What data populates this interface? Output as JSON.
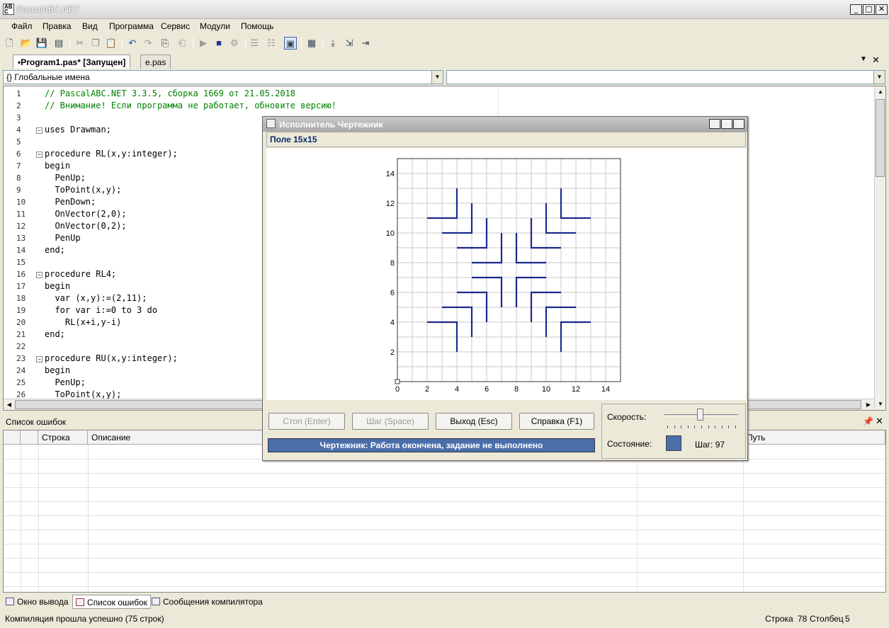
{
  "window": {
    "title": "PascalABC.NET"
  },
  "menu": [
    "Файл",
    "Правка",
    "Вид",
    "Программа",
    "Сервис",
    "Модули",
    "Помощь"
  ],
  "tabs": [
    {
      "label": "•Program1.pas* [Запущен]",
      "active": true
    },
    {
      "label": "e.pas",
      "active": false
    }
  ],
  "dropdowns": {
    "left": "{} Глобальные имена",
    "right": ""
  },
  "editor": {
    "lines": [
      {
        "n": "1",
        "text": "// PascalABC.NET 3.3.5, сборка 1669 от 21.05.2018",
        "kind": "comment"
      },
      {
        "n": "2",
        "text": "// Внимание! Если программа не работает, обновите версию!",
        "kind": "comment"
      },
      {
        "n": "3",
        "text": "",
        "kind": "code"
      },
      {
        "n": "4",
        "text": "uses Drawman;",
        "kind": "code",
        "fold": true
      },
      {
        "n": "5",
        "text": "",
        "kind": "code"
      },
      {
        "n": "6",
        "text": "procedure RL(x,y:integer);",
        "kind": "code",
        "fold": true
      },
      {
        "n": "7",
        "text": "begin",
        "kind": "code"
      },
      {
        "n": "8",
        "text": "  PenUp;",
        "kind": "code"
      },
      {
        "n": "9",
        "text": "  ToPoint(x,y);",
        "kind": "code"
      },
      {
        "n": "10",
        "text": "  PenDown;",
        "kind": "code"
      },
      {
        "n": "11",
        "text": "  OnVector(2,0);",
        "kind": "code"
      },
      {
        "n": "12",
        "text": "  OnVector(0,2);",
        "kind": "code"
      },
      {
        "n": "13",
        "text": "  PenUp",
        "kind": "code"
      },
      {
        "n": "14",
        "text": "end;",
        "kind": "code"
      },
      {
        "n": "15",
        "text": "",
        "kind": "code"
      },
      {
        "n": "16",
        "text": "procedure RL4;",
        "kind": "code",
        "fold": true
      },
      {
        "n": "17",
        "text": "begin",
        "kind": "code"
      },
      {
        "n": "18",
        "text": "  var (x,y):=(2,11);",
        "kind": "code"
      },
      {
        "n": "19",
        "text": "  for var i:=0 to 3 do",
        "kind": "code"
      },
      {
        "n": "20",
        "text": "    RL(x+i,y-i)",
        "kind": "code"
      },
      {
        "n": "21",
        "text": "end;",
        "kind": "code"
      },
      {
        "n": "22",
        "text": "",
        "kind": "code"
      },
      {
        "n": "23",
        "text": "procedure RU(x,y:integer);",
        "kind": "code",
        "fold": true
      },
      {
        "n": "24",
        "text": "begin",
        "kind": "code"
      },
      {
        "n": "25",
        "text": "  PenUp;",
        "kind": "code"
      },
      {
        "n": "26",
        "text": "  ToPoint(x,y);",
        "kind": "code"
      }
    ]
  },
  "errors_panel": {
    "title": "Список ошибок",
    "columns": [
      "",
      "",
      "Строка",
      "Описание",
      "",
      "Путь"
    ]
  },
  "bottom_tabs": [
    "Окно вывода",
    "Список ошибок",
    "Сообщения компилятора"
  ],
  "status": {
    "message": "Компиляция прошла успешно (75 строк)",
    "line_label": "Строка",
    "line_value": "78",
    "col_label": "Столбец",
    "col_value": "5"
  },
  "drawman": {
    "title": "Исполнитель Чертежник",
    "field_label": "Поле 15x15",
    "buttons": [
      "Стоп (Enter)",
      "Шаг (Space)",
      "Выход (Esc)",
      "Справка (F1)"
    ],
    "status_text": "Чертежник: Работа окончена, задание не выполнено",
    "speed_label": "Скорость:",
    "state_label": "Состояние:",
    "step_label": "Шаг: 97",
    "speed_fraction": 0.5,
    "state_color": "#4a6eaa",
    "ticks": [
      "0",
      "2",
      "4",
      "6",
      "8",
      "10",
      "12",
      "14"
    ],
    "grid_size": 15,
    "line_color": "#1a2a8a",
    "segments": [
      [
        [
          2,
          11
        ],
        [
          4,
          11
        ],
        [
          4,
          13
        ]
      ],
      [
        [
          3,
          10
        ],
        [
          5,
          10
        ],
        [
          5,
          12
        ]
      ],
      [
        [
          4,
          9
        ],
        [
          6,
          9
        ],
        [
          6,
          11
        ]
      ],
      [
        [
          5,
          8
        ],
        [
          7,
          8
        ],
        [
          7,
          10
        ]
      ],
      [
        [
          13,
          11
        ],
        [
          11,
          11
        ],
        [
          11,
          13
        ]
      ],
      [
        [
          12,
          10
        ],
        [
          10,
          10
        ],
        [
          10,
          12
        ]
      ],
      [
        [
          11,
          9
        ],
        [
          9,
          9
        ],
        [
          9,
          11
        ]
      ],
      [
        [
          10,
          8
        ],
        [
          8,
          8
        ],
        [
          8,
          10
        ]
      ],
      [
        [
          2,
          4
        ],
        [
          4,
          4
        ],
        [
          4,
          2
        ]
      ],
      [
        [
          3,
          5
        ],
        [
          5,
          5
        ],
        [
          5,
          3
        ]
      ],
      [
        [
          4,
          6
        ],
        [
          6,
          6
        ],
        [
          6,
          4
        ]
      ],
      [
        [
          5,
          7
        ],
        [
          7,
          7
        ],
        [
          7,
          5
        ]
      ],
      [
        [
          13,
          4
        ],
        [
          11,
          4
        ],
        [
          11,
          2
        ]
      ],
      [
        [
          12,
          5
        ],
        [
          10,
          5
        ],
        [
          10,
          3
        ]
      ],
      [
        [
          11,
          6
        ],
        [
          9,
          6
        ],
        [
          9,
          4
        ]
      ],
      [
        [
          10,
          7
        ],
        [
          8,
          7
        ],
        [
          8,
          5
        ]
      ]
    ]
  }
}
